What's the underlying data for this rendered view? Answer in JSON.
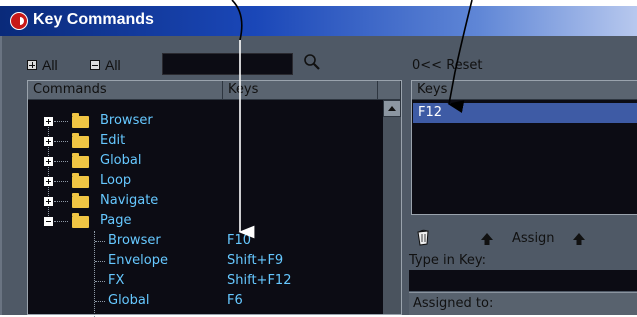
{
  "window": {
    "title": "Key Commands"
  },
  "toolbar": {
    "expand_all": "All",
    "collapse_all": "All",
    "search_value": "",
    "reset_label": "0<< Reset"
  },
  "commands_panel": {
    "headers": {
      "commands": "Commands",
      "keys": "Keys"
    },
    "folders": [
      {
        "label": "Browser",
        "expanded": false
      },
      {
        "label": "Edit",
        "expanded": false
      },
      {
        "label": "Global",
        "expanded": false
      },
      {
        "label": "Loop",
        "expanded": false
      },
      {
        "label": "Navigate",
        "expanded": false
      },
      {
        "label": "Page",
        "expanded": true
      }
    ],
    "page_items": [
      {
        "label": "Browser",
        "key": "F10"
      },
      {
        "label": "Envelope",
        "key": "Shift+F9"
      },
      {
        "label": "FX",
        "key": "Shift+F12"
      },
      {
        "label": "Global",
        "key": "F6"
      }
    ]
  },
  "keys_panel": {
    "header": "Keys",
    "keys": [
      "F12"
    ]
  },
  "assign": {
    "assign_label": "Assign",
    "type_in_key_label": "Type in Key:",
    "assigned_to_label": "Assigned to:"
  },
  "colors": {
    "title_bar": "#1a47b8",
    "panel_bg": "#4f5966",
    "list_bg": "#0c0c14",
    "item_text": "#66c8ff",
    "selection": "#3e5ba5",
    "folder": "#f0c544"
  }
}
